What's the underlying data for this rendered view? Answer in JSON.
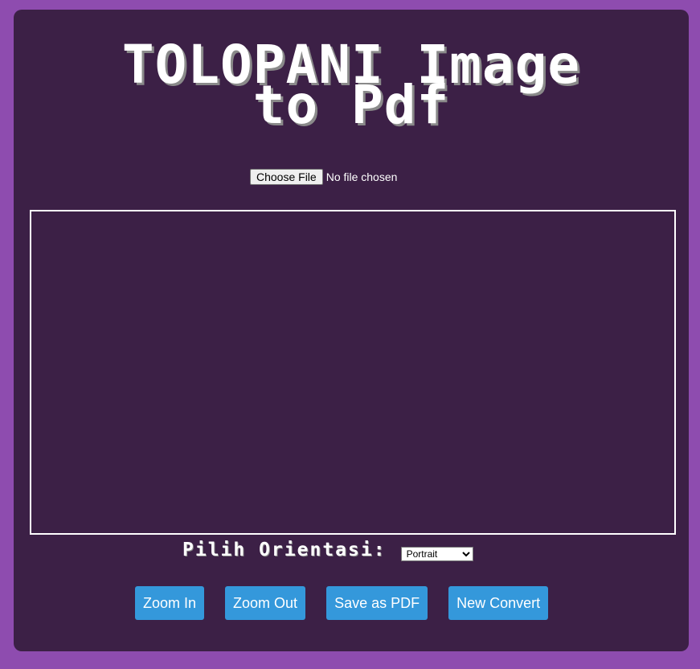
{
  "title": {
    "line1": "TOLOPANI Image",
    "line2": "to Pdf"
  },
  "file_input": {
    "button_label": "Choose File",
    "status": "No file chosen"
  },
  "orientation": {
    "label": "Pilih Orientasi:",
    "selected": "Portrait"
  },
  "buttons": {
    "zoom_in": "Zoom In",
    "zoom_out": "Zoom Out",
    "save_pdf": "Save as PDF",
    "new_convert": "New Convert"
  },
  "colors": {
    "page_background": "#8e4caf",
    "card_background": "#3c2046",
    "button_accent": "#3498db"
  }
}
